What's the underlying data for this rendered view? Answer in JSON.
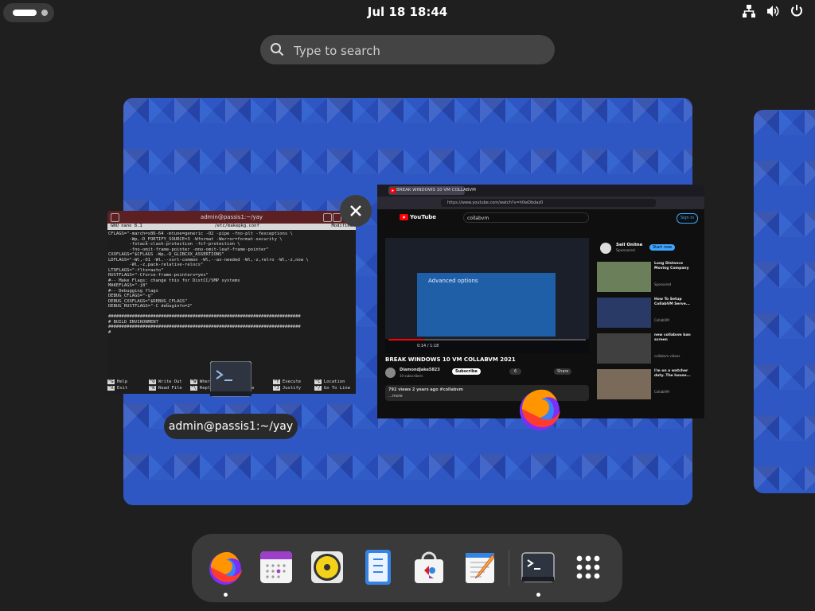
{
  "topbar": {
    "clock": "Jul 18  18:44",
    "icons": [
      "network-icon",
      "volume-icon",
      "power-icon"
    ]
  },
  "search": {
    "placeholder": "Type to search"
  },
  "overview": {
    "tooltip": "admin@passis1:~/yay",
    "terminal_window": {
      "title": "admin@passis1:~/yay",
      "nano_version": "GNU nano 8.1",
      "file": "/etc/makepkg.conf",
      "state": "Modified",
      "lines": [
        "CFLAGS=\"-march=x86-64 -mtune=generic -O2 -pipe -fno-plt -fexceptions \\",
        "        -Wp,-D_FORTIFY_SOURCE=3 -Wformat -Werror=format-security \\",
        "        -fstack-clash-protection -fcf-protection \\",
        "        -fno-omit-frame-pointer -mno-omit-leaf-frame-pointer\"",
        "CXXFLAGS=\"$CFLAGS -Wp,-D_GLIBCXX_ASSERTIONS\"",
        "LDFLAGS=\"-Wl,-O1 -Wl,--sort-common -Wl,--as-needed -Wl,-z,relro -Wl,-z,now \\",
        "        -Wl,-z,pack-relative-relocs\"",
        "LTOFLAGS=\"-flto=auto\"",
        "RUSTFLAGS=\"-Cforce-frame-pointers=yes\"",
        "#-- Make Flags: change this for DistCC/SMP systems",
        "MAKEFLAGS=\"-j8\"",
        "#-- Debugging flags",
        "DEBUG_CFLAGS=\"-g\"",
        "DEBUG_CXXFLAGS=\"$DEBUG_CFLAGS\"",
        "DEBUG_RUSTFLAGS=\"-C debuginfo=2\"",
        "",
        "#########################################################################",
        "# BUILD ENVIRONMENT",
        "#########################################################################",
        "#"
      ],
      "shortcuts_row1": [
        [
          "^G",
          "Help"
        ],
        [
          "^O",
          "Write Out"
        ],
        [
          "^W",
          "Where Is"
        ],
        [
          "^K",
          "Cut"
        ],
        [
          "^T",
          "Execute"
        ],
        [
          "^C",
          "Location"
        ]
      ],
      "shortcuts_row2": [
        [
          "^X",
          "Exit"
        ],
        [
          "^R",
          "Read File"
        ],
        [
          "^\\",
          "Replace"
        ],
        [
          "^U",
          "Paste"
        ],
        [
          "^J",
          "Justify"
        ],
        [
          "^/",
          "Go To Line"
        ]
      ]
    },
    "firefox_window": {
      "tab_title": "BREAK WINDOWS 10 VM COLLABVM",
      "url": "https://www.youtube.com/watch?v=h0wDbdaz0",
      "yt_logo": "YouTube",
      "yt_search": "collabvm",
      "sign_in": "Sign in",
      "player_label": "Advanced options",
      "time": "0:14 / 1:18",
      "progress": 0.18,
      "video_title": "BREAK WINDOWS 10 VM COLLABVM 2021",
      "channel": "DiamondJake5823",
      "subscribers": "10 subscribers",
      "subscribe": "Subscribe",
      "likes": "6",
      "share": "Share",
      "views": "792 views  2 years ago  #collabvm",
      "more": "...more",
      "ad_title": "Sell Online",
      "ad_sponsor": "Sponsored",
      "ad_button": "Start now",
      "side_videos": [
        {
          "title": "Long Distance Moving Company",
          "meta": "Sponsored"
        },
        {
          "title": "How To Setup CollabVM Serve...",
          "meta": "CollabVM"
        },
        {
          "title": "new collabvm ban screen",
          "meta": "collabvm videos"
        },
        {
          "title": "I'm on a watcher duty. The house...",
          "meta": "CollabVM"
        }
      ]
    }
  },
  "dock": {
    "apps": [
      "firefox",
      "calendar",
      "rhythmbox",
      "text-editor-notes",
      "software",
      "text-editor",
      "terminal",
      "show-apps"
    ]
  }
}
